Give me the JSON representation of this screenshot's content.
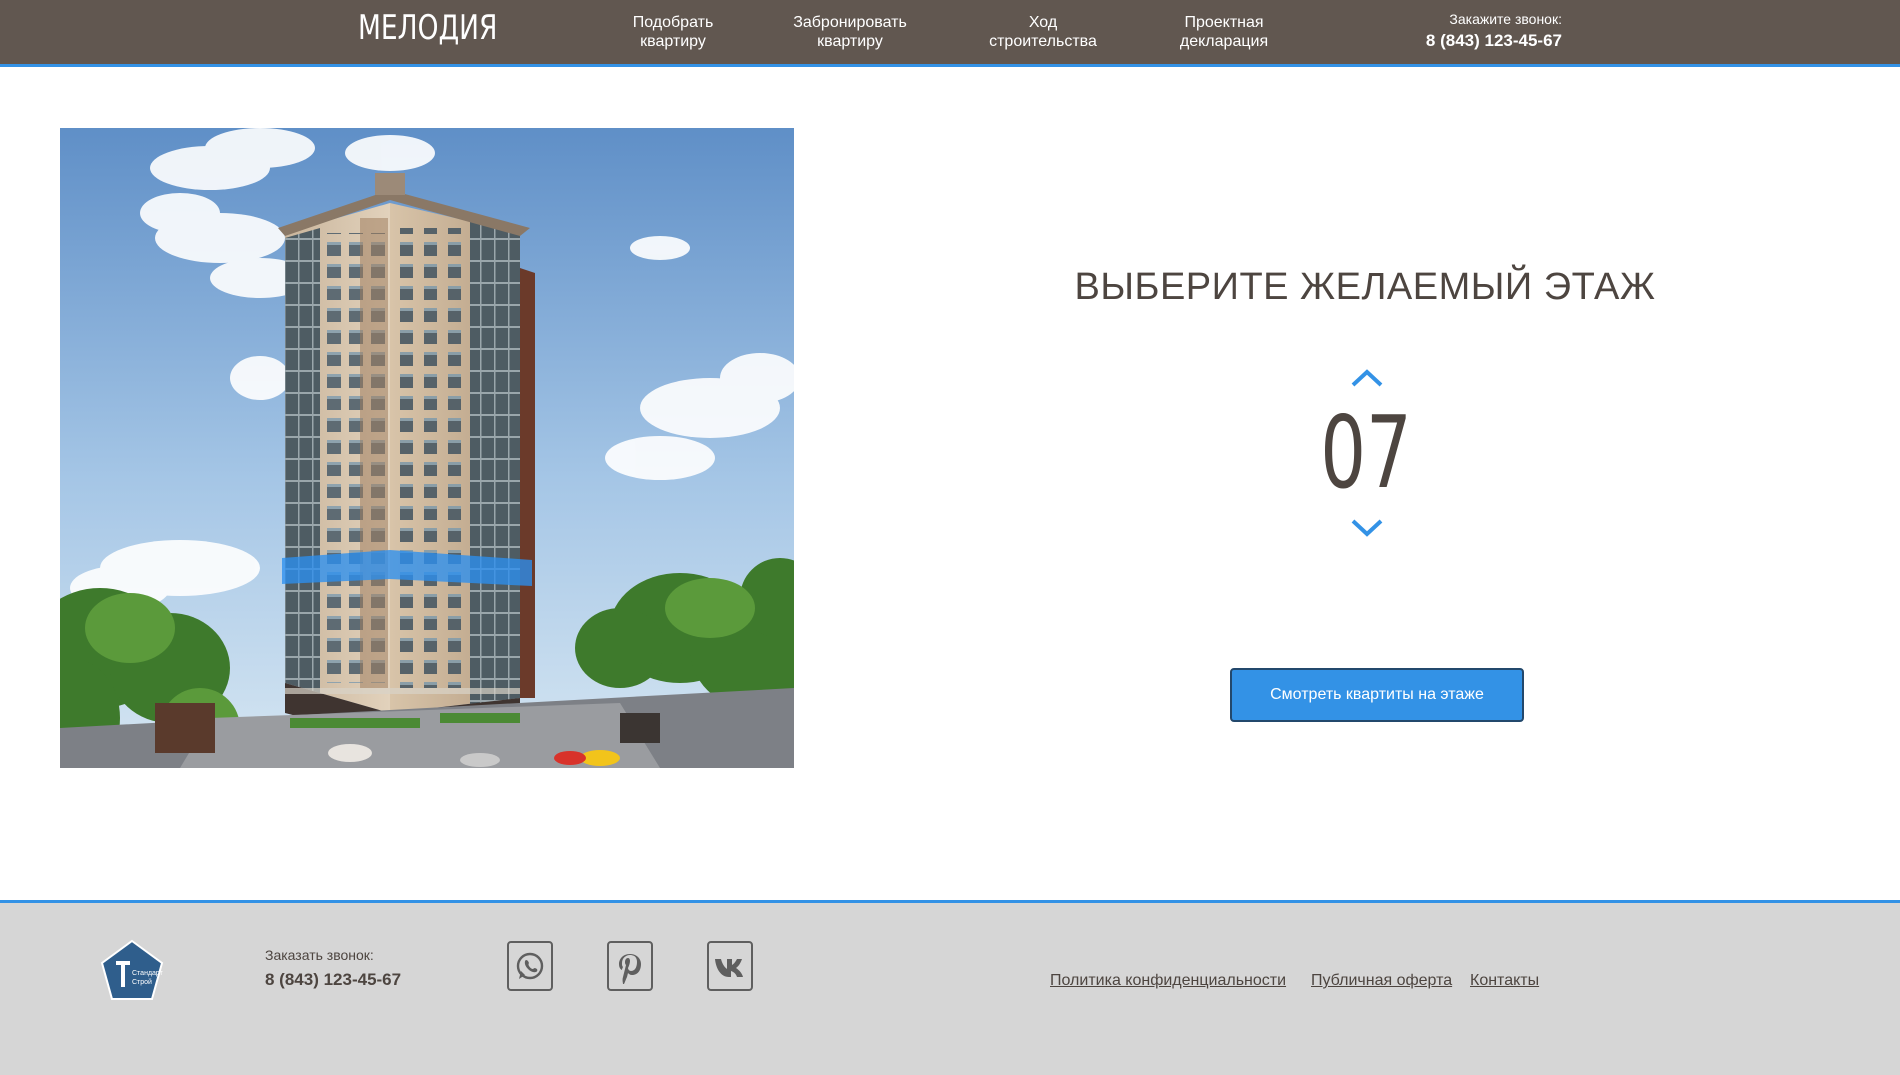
{
  "header": {
    "logo": "МЕЛОДИЯ",
    "nav": [
      {
        "line1": "Подобрать",
        "line2": "квартиру"
      },
      {
        "line1": "Забронировать",
        "line2": "квартиру"
      },
      {
        "line1": "Ход",
        "line2": "строительства"
      },
      {
        "line1": "Проектная",
        "line2": "декларация"
      }
    ],
    "callback_label": "Закажите звонок:",
    "callback_phone": "8 (843) 123-45-67"
  },
  "picker": {
    "title": "ВЫБЕРИТЕ ЖЕЛАЕМЫЙ ЭТАЖ",
    "floor": "07",
    "button": "Смотреть квартиты на этаже"
  },
  "colors": {
    "header_bg": "#615750",
    "accent": "#3392e6",
    "footer_bg": "#d6d6d6",
    "text": "#4d4540"
  },
  "footer": {
    "logo_text": "СтандартСтрой",
    "call_label": "Заказать звонок:",
    "call_phone": "8 (843) 123-45-67",
    "social": [
      "whatsapp-icon",
      "pinterest-icon",
      "vk-icon"
    ],
    "links": [
      "Политика конфиденциальности",
      "Публичная оферта",
      "Контакты"
    ]
  }
}
